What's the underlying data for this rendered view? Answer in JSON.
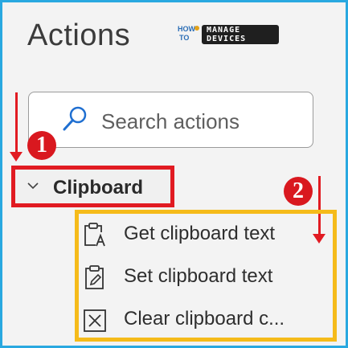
{
  "panel": {
    "title": "Actions",
    "search": {
      "placeholder": "Search actions",
      "icon": "search-icon"
    }
  },
  "watermark": {
    "line1": "HOW",
    "line2": "TO",
    "word1": "MANAGE",
    "word2": "DEVICES"
  },
  "annotations": {
    "step1": "1",
    "step2": "2",
    "colors": {
      "red": "#e11b22",
      "yellow": "#f5bb1a",
      "frame": "#29a8e0"
    }
  },
  "group": {
    "label": "Clipboard",
    "expanded": true,
    "items": [
      {
        "label": "Get clipboard text",
        "icon": "clipboard-get-text-icon"
      },
      {
        "label": "Set clipboard text",
        "icon": "clipboard-set-text-icon"
      },
      {
        "label": "Clear clipboard c...",
        "icon": "clear-clipboard-icon"
      }
    ]
  }
}
